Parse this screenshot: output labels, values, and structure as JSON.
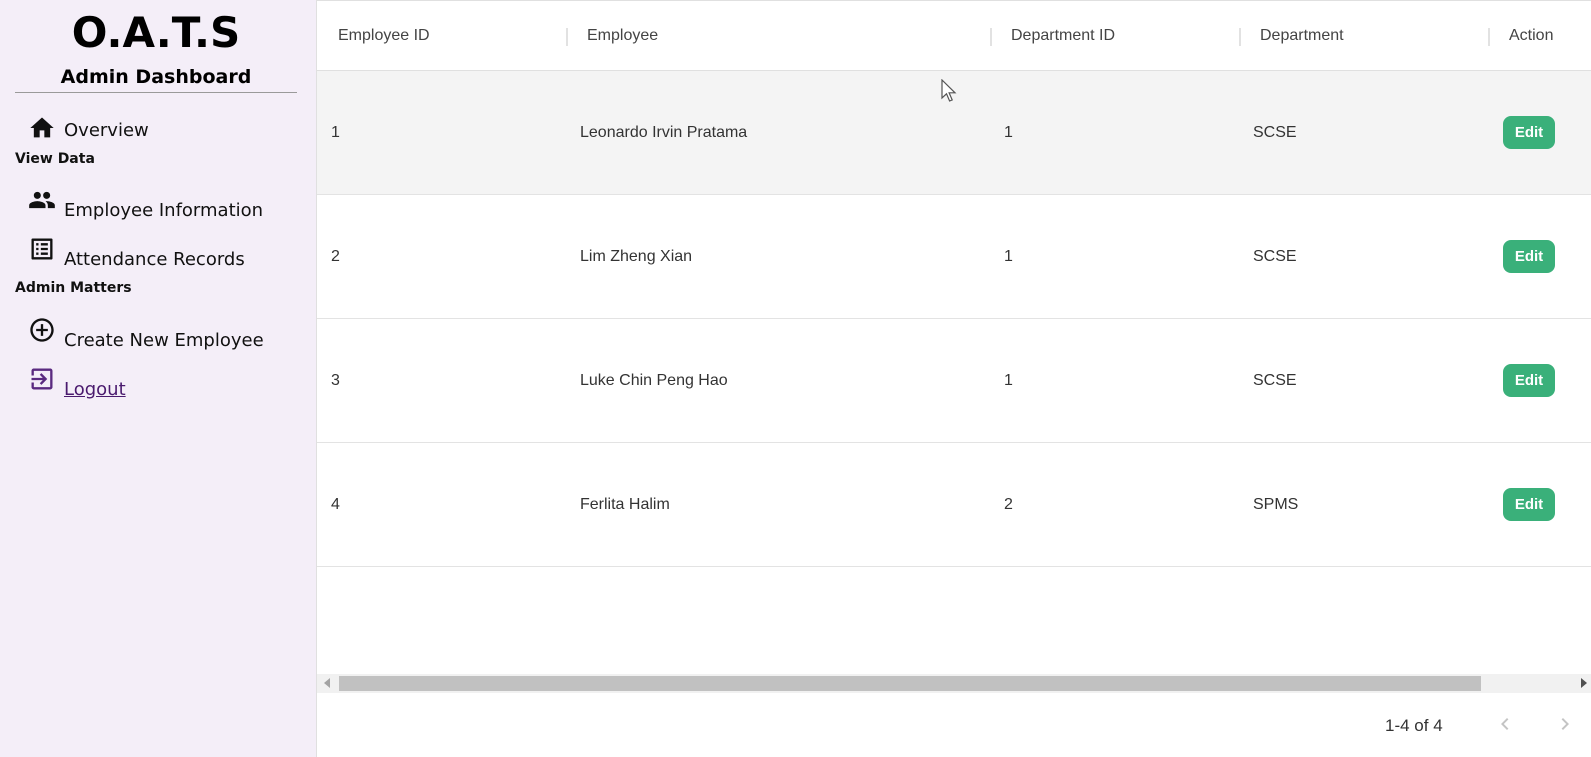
{
  "sidebar": {
    "brand_title": "O.A.T.S",
    "brand_subtitle": "Admin Dashboard",
    "overview": {
      "label": "Overview",
      "icon": "home-icon"
    },
    "section_view_data": "View Data",
    "employee_info": {
      "label": "Employee Information",
      "icon": "people-icon"
    },
    "attendance": {
      "label": "Attendance Records",
      "icon": "list-icon"
    },
    "section_admin": "Admin Matters",
    "create_employee": {
      "label": "Create New Employee",
      "icon": "add-circle-icon"
    },
    "logout": {
      "label": "Logout",
      "icon": "logout-icon"
    }
  },
  "table": {
    "columns": [
      "Employee ID",
      "Employee",
      "Department ID",
      "Department",
      "Action"
    ],
    "rows": [
      {
        "id": "1",
        "name": "Leonardo Irvin Pratama",
        "dept_id": "1",
        "dept": "SCSE",
        "action": "Edit"
      },
      {
        "id": "2",
        "name": "Lim Zheng Xian",
        "dept_id": "1",
        "dept": "SCSE",
        "action": "Edit"
      },
      {
        "id": "3",
        "name": "Luke Chin Peng Hao",
        "dept_id": "1",
        "dept": "SCSE",
        "action": "Edit"
      },
      {
        "id": "4",
        "name": "Ferlita Halim",
        "dept_id": "2",
        "dept": "SPMS",
        "action": "Edit"
      }
    ]
  },
  "pagination": {
    "text": "1-4 of 4"
  },
  "colors": {
    "sidebar_bg": "#f4eef8",
    "accent_green": "#3ab07a",
    "logout_link": "#4a1a6e"
  }
}
